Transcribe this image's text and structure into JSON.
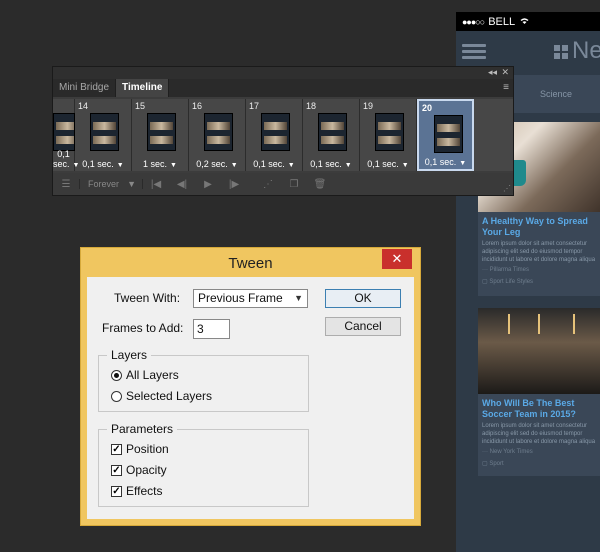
{
  "phone": {
    "carrier": "BELL",
    "signal_dots": "●●●○○",
    "time": "4:",
    "logo_text": "Ne",
    "tab_label": "Science",
    "cards": [
      {
        "title": "A Healthy Way to Spread Your Leg",
        "body": "Lorem ipsum dolor sit amet consectetur adipiscing elit sed do eiusmod tempor incididunt ut labore et dolore magna aliqua",
        "source": "Pillarma Times",
        "section": "Sport Life Styles"
      },
      {
        "title": "Who Will Be The Best Soccer Team in 2015?",
        "body": "Lorem ipsum dolor sit amet consectetur adipiscing elit sed do eiusmod tempor incididunt ut labore et dolore magna aliqua",
        "source": "New York Times",
        "section": "Sport"
      }
    ]
  },
  "panel": {
    "tabs": [
      "Mini Bridge",
      "Timeline"
    ],
    "collapse_icon": "◂◂",
    "close_icon": "✕",
    "menu_icon": "≡",
    "frames": [
      {
        "num": "",
        "delay": "0,1 sec."
      },
      {
        "num": "14",
        "delay": "0,1 sec."
      },
      {
        "num": "15",
        "delay": "1 sec."
      },
      {
        "num": "16",
        "delay": "0,2 sec."
      },
      {
        "num": "17",
        "delay": "0,1 sec."
      },
      {
        "num": "18",
        "delay": "0,1 sec."
      },
      {
        "num": "19",
        "delay": "0,1 sec."
      },
      {
        "num": "20",
        "delay": "0,1 sec.",
        "selected": true
      }
    ],
    "loop": "Forever",
    "icons": [
      "convert-icon",
      "first-frame-icon",
      "prev-frame-icon",
      "play-icon",
      "next-frame-icon",
      "tween-icon",
      "duplicate-frame-icon",
      "delete-frame-icon"
    ]
  },
  "dialog": {
    "title": "Tween",
    "close_label": "✕",
    "tween_with_label": "Tween With:",
    "tween_with_value": "Previous Frame",
    "frames_to_add_label": "Frames to Add:",
    "frames_to_add_value": "3",
    "ok_label": "OK",
    "cancel_label": "Cancel",
    "layers_legend": "Layers",
    "all_layers_label": "All Layers",
    "selected_layers_label": "Selected Layers",
    "parameters_legend": "Parameters",
    "position_label": "Position",
    "opacity_label": "Opacity",
    "effects_label": "Effects",
    "check_mark": "✓"
  }
}
